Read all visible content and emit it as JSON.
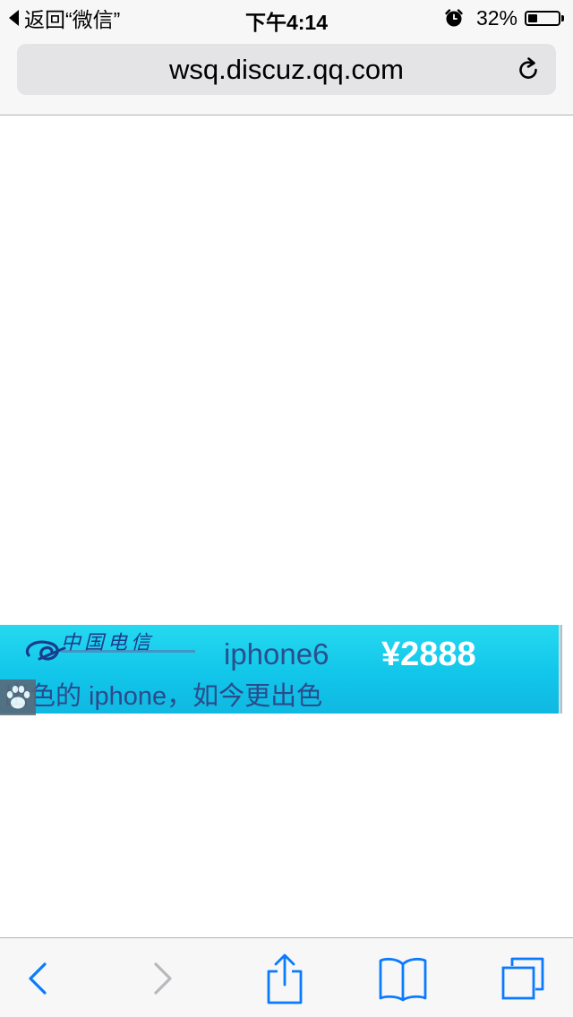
{
  "status_bar": {
    "back_label": "返回“微信”",
    "time": "下午4:14",
    "battery_percent": "32%",
    "battery_level": 0.32,
    "icons": [
      "back-triangle-icon",
      "alarm-icon",
      "battery-icon"
    ]
  },
  "address_bar": {
    "url": "wsq.discuz.qq.com",
    "reload_icon": "reload-icon"
  },
  "ad": {
    "brand_text": "中国电信",
    "product": "iphone6",
    "price": "¥2888",
    "slogan": "出色的 iphone，如今更出色",
    "badge_icon": "paw-icon"
  },
  "toolbar": {
    "buttons": [
      {
        "name": "back-button",
        "icon": "chevron-left-icon",
        "enabled": true
      },
      {
        "name": "forward-button",
        "icon": "chevron-right-icon",
        "enabled": false
      },
      {
        "name": "share-button",
        "icon": "share-icon",
        "enabled": true
      },
      {
        "name": "bookmarks-button",
        "icon": "book-icon",
        "enabled": true
      },
      {
        "name": "tabs-button",
        "icon": "tabs-icon",
        "enabled": true
      }
    ]
  },
  "colors": {
    "accent": "#0a7aff",
    "disabled": "#b8b8bd",
    "bar_bg": "#f7f7f7",
    "address_bg": "#e4e4e6",
    "ad_bg": "#12c6ea"
  }
}
